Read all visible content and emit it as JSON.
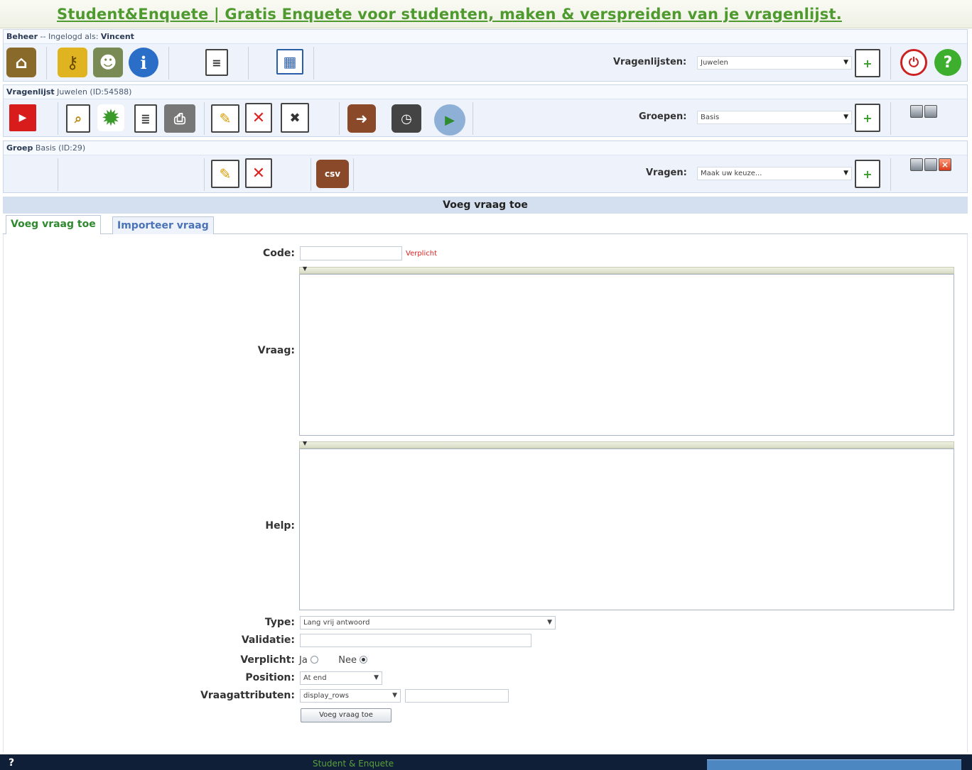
{
  "page": {
    "title": "Student&Enquete | Gratis Enquete voor studenten, maken & verspreiden van je vragenlijst."
  },
  "beheer": {
    "label": "Beheer",
    "logged_in_text": "-- Ingelogd als:",
    "user": "Vincent",
    "vragenlijsten_label": "Vragenlijsten:",
    "vragenlijsten_value": "Juwelen"
  },
  "vragenlijst": {
    "label": "Vragenlijst",
    "name_id": "Juwelen (ID:54588)",
    "groepen_label": "Groepen:",
    "groepen_value": "Basis"
  },
  "groep": {
    "label": "Groep",
    "name_id": "Basis (ID:29)",
    "vragen_label": "Vragen:",
    "vragen_value": "Maak uw keuze..."
  },
  "section": {
    "title": "Voeg vraag toe"
  },
  "tabs": [
    {
      "label": "Voeg vraag toe"
    },
    {
      "label": "Importeer vraag"
    }
  ],
  "form": {
    "code_label": "Code:",
    "code_value": "",
    "required_text": "Verplicht",
    "vraag_label": "Vraag:",
    "help_label": "Help:",
    "type_label": "Type:",
    "type_value": "Lang vrij antwoord",
    "validatie_label": "Validatie:",
    "verplicht_label": "Verplicht:",
    "ja_label": "Ja",
    "nee_label": "Nee",
    "verplicht_selected": "Nee",
    "position_label": "Position:",
    "position_value": "At end",
    "attributes_label": "Vraagattributen:",
    "attributes_value": "display_rows",
    "submit_label": "Voeg vraag toe"
  },
  "footer": {
    "help": "?",
    "brand": "Student & Enquete"
  },
  "colors": {
    "title_green": "#4e9a2e",
    "panel_blue": "#eef3fb",
    "footer_navy": "#0f1f38",
    "required_red": "#dd2222"
  },
  "icons": [
    "home-icon",
    "key-icon",
    "users-icon",
    "info-icon",
    "document-icon",
    "grid-icon",
    "new-document-icon",
    "power-icon",
    "help-icon",
    "stop-activate-icon",
    "preview-icon",
    "settings-icon",
    "print-preview-icon",
    "printer-icon",
    "edit-icon",
    "delete-icon",
    "delete-responses-icon",
    "export-icon",
    "statistics-icon",
    "test-survey-icon",
    "csv-import-icon",
    "minimize-icon",
    "maximize-icon",
    "close-icon"
  ]
}
